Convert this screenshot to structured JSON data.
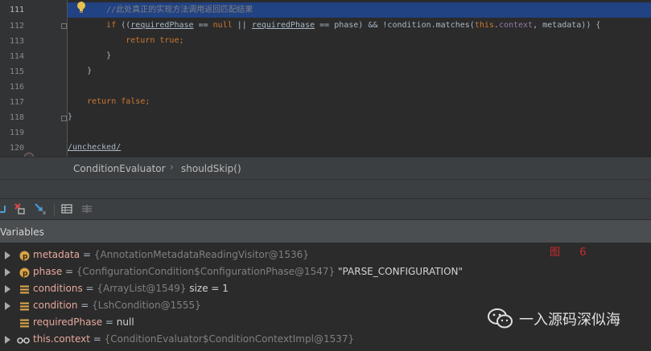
{
  "editor": {
    "lines": [
      {
        "num": "111",
        "tokens": [
          {
            "t": "        //此处真正的实现方法调用返回匹配结果",
            "c": "cmt"
          }
        ]
      },
      {
        "num": "112",
        "tokens": [
          {
            "t": "        ",
            "c": ""
          },
          {
            "t": "if",
            "c": "kw"
          },
          {
            "t": " ((",
            "c": ""
          },
          {
            "t": "requiredPhase",
            "c": "ul"
          },
          {
            "t": " == ",
            "c": ""
          },
          {
            "t": "null",
            "c": "kw"
          },
          {
            "t": " || ",
            "c": ""
          },
          {
            "t": "requiredPhase",
            "c": "ul"
          },
          {
            "t": " == phase) && !condition.matches(",
            "c": ""
          },
          {
            "t": "this",
            "c": "kw"
          },
          {
            "t": ".",
            "c": ""
          },
          {
            "t": "context",
            "c": "fld"
          },
          {
            "t": ", metadata)) {",
            "c": ""
          }
        ]
      },
      {
        "num": "113",
        "tokens": [
          {
            "t": "            ",
            "c": ""
          },
          {
            "t": "return true",
            "c": "kw"
          },
          {
            "t": ";",
            "c": "kw"
          }
        ]
      },
      {
        "num": "114",
        "tokens": [
          {
            "t": "        }",
            "c": ""
          }
        ]
      },
      {
        "num": "115",
        "tokens": [
          {
            "t": "    }",
            "c": ""
          }
        ]
      },
      {
        "num": "116",
        "tokens": [
          {
            "t": "",
            "c": ""
          }
        ]
      },
      {
        "num": "117",
        "tokens": [
          {
            "t": "    ",
            "c": ""
          },
          {
            "t": "return false",
            "c": "kw"
          },
          {
            "t": ";",
            "c": "kw"
          }
        ]
      },
      {
        "num": "118",
        "tokens": [
          {
            "t": "}",
            "c": ""
          }
        ]
      },
      {
        "num": "119",
        "tokens": [
          {
            "t": "",
            "c": ""
          }
        ]
      },
      {
        "num": "120",
        "tokens": [
          {
            "t": "/unchecked/",
            "c": "ul"
          }
        ]
      }
    ]
  },
  "breadcrumb": {
    "class_name": "ConditionEvaluator",
    "separator": "›",
    "method_name": "shouldSkip()"
  },
  "toolbar": {
    "icons": [
      "restore-layout-icon",
      "remove-watch-icon",
      "step-over-icon",
      "table-view-icon",
      "settings-lines-icon"
    ]
  },
  "variables_panel": {
    "title": "Variables",
    "rows": [
      {
        "icon": "p",
        "expandable": true,
        "name": "metadata",
        "eq": " = ",
        "ref": "{AnnotationMetadataReadingVisitor@1536}",
        "extra": ""
      },
      {
        "icon": "p",
        "expandable": true,
        "name": "phase",
        "eq": " = ",
        "ref": "{ConfigurationCondition$ConfigurationPhase@1547}",
        "extra": " \"PARSE_CONFIGURATION\""
      },
      {
        "icon": "list",
        "expandable": true,
        "name": "conditions",
        "eq": " = ",
        "ref": "{ArrayList@1549}",
        "extra": "  size = 1"
      },
      {
        "icon": "list",
        "expandable": true,
        "name": "condition",
        "eq": " = ",
        "ref": "{LshCondition@1555}",
        "extra": ""
      },
      {
        "icon": "list",
        "expandable": false,
        "name": "requiredPhase",
        "eq": " = ",
        "ref": "",
        "extra": "null"
      },
      {
        "icon": "glasses",
        "expandable": true,
        "name": "this.context",
        "eq": " = ",
        "ref": "{ConditionEvaluator$ConditionContextImpl@1537}",
        "extra": ""
      }
    ]
  },
  "figure_label": "图 6",
  "watermark": "一入源码深似海",
  "colors": {
    "editor_bg": "#2b2b2b",
    "current_line": "#214283",
    "keyword": "#cc7832",
    "field": "#9876aa",
    "comment": "#808080",
    "var_name": "#e8a99e",
    "figure_label": "#cc2b2b"
  }
}
